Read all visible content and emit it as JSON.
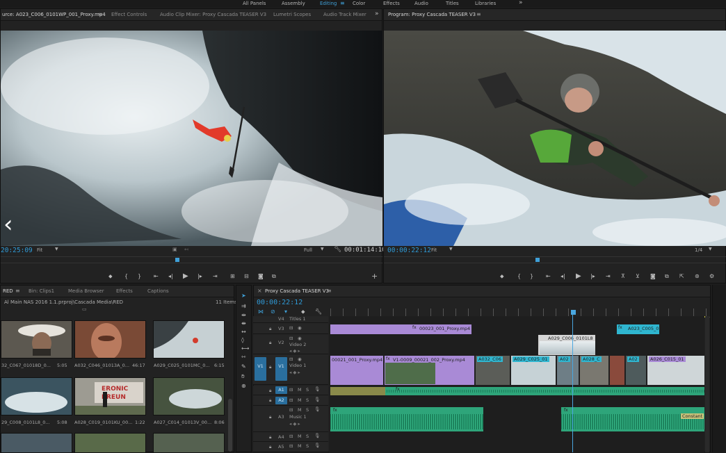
{
  "workspace": {
    "items": [
      "All Panels",
      "Assembly",
      "Editing",
      "Color",
      "Effects",
      "Audio",
      "Titles",
      "Libraries"
    ],
    "active": "Editing",
    "overflow_icon": "double-chevron-right"
  },
  "source": {
    "tabs": [
      "urce: A023_C006_0101WP_001_Proxy.mp4",
      "Effect Controls",
      "Audio Clip Mixer: Proxy Cascada TEASER V3",
      "Lumetri Scopes",
      "Audio Track Mixer"
    ],
    "timecode": "20:25:09",
    "fit": "Fit",
    "quality": "Full",
    "duration": "00:01:14:10"
  },
  "program": {
    "tab": "Program: Proxy Cascada TEASER V3",
    "timecode": "00:00:22:12",
    "fit": "Fit",
    "resolution": "1/4"
  },
  "project": {
    "tabs": [
      "RED",
      "Bin: Clips1",
      "Media Browser",
      "Effects",
      "Captions"
    ],
    "path": "Al Main NAS 2016 1.1.prproj\\Cascada Media\\RED",
    "count": "11 Items",
    "items": [
      {
        "name": "32_C067_01018D_0...",
        "dur": "5:05"
      },
      {
        "name": "A032_C046_01013A_0...",
        "dur": "46:17"
      },
      {
        "name": "A029_C025_0101MC_0...",
        "dur": "6:15"
      },
      {
        "name": "29_C008_0101L8_0...",
        "dur": "5:08"
      },
      {
        "name": "A028_C019_0101KU_00...",
        "dur": "1:22"
      },
      {
        "name": "A027_C014_01013V_00...",
        "dur": "8:06"
      }
    ],
    "sign_text": [
      "ERONIC",
      "RREUN"
    ]
  },
  "timeline": {
    "tab": "Proxy Cascada TEASER V3",
    "timecode": "00:00:22:12",
    "tracks": {
      "v4": "V4",
      "titles": "Titles 1",
      "v3": "V3",
      "v2": "V2",
      "v2name": "Video 2",
      "v1src": "V1",
      "v1": "V1",
      "v1name": "Video 1",
      "a1src": "A1",
      "a1": "A1",
      "a2": "A2",
      "a3": "A3",
      "a3name": "Music 1",
      "a4": "A4",
      "a5": "A5",
      "m": "M",
      "s": "S"
    },
    "clips": {
      "v3a": "00023_001_Proxy.mp4",
      "v3b": "A023_C005_0",
      "v2a": "A029_C006_0101L8",
      "v1a": "00021_001_Proxy.mp4",
      "v1b": "V1-0009_00021_002_Proxy.mp4",
      "v1c": "A032_C06",
      "v1d": "A029_C025_01",
      "v1e": "A02",
      "v1f": "A028_C",
      "v1g": "A02",
      "v1h": "A026_C015_01",
      "fx": "fx",
      "constant": "Constant"
    }
  },
  "colors": {
    "accent": "#2f9bd8",
    "clip_purple": "#a98ad6",
    "clip_cyan": "#2fb6d0",
    "clip_audio": "#2ea57a",
    "playhead": "#4aa7e0"
  }
}
